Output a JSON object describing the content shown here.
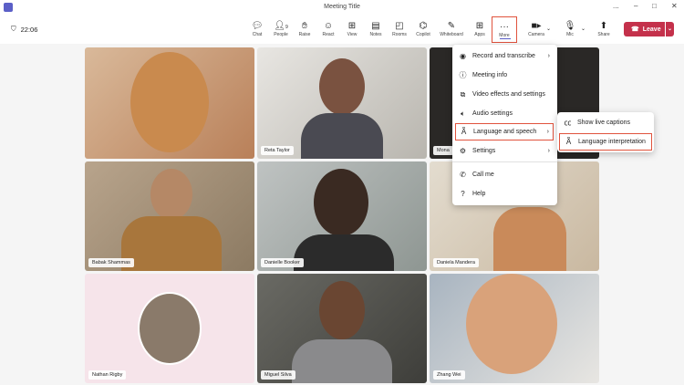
{
  "window": {
    "title": "Meeting Title",
    "controls": [
      "...",
      "–",
      "□",
      "✕"
    ]
  },
  "toolbar": {
    "timer": "22:06",
    "people_count": "9",
    "buttons": [
      {
        "label": "Chat",
        "icon": "chat-icon"
      },
      {
        "label": "People",
        "icon": "people-icon"
      },
      {
        "label": "Raise",
        "icon": "raise-hand-icon"
      },
      {
        "label": "React",
        "icon": "react-icon"
      },
      {
        "label": "View",
        "icon": "view-icon"
      },
      {
        "label": "Notes",
        "icon": "notes-icon"
      },
      {
        "label": "Rooms",
        "icon": "rooms-icon"
      },
      {
        "label": "Copilot",
        "icon": "copilot-icon"
      },
      {
        "label": "Whiteboard",
        "icon": "whiteboard-icon"
      },
      {
        "label": "Apps",
        "icon": "apps-icon"
      },
      {
        "label": "More",
        "icon": "more-icon"
      },
      {
        "label": "Camera",
        "icon": "camera-icon"
      },
      {
        "label": "Mic",
        "icon": "mic-icon"
      },
      {
        "label": "Share",
        "icon": "share-icon"
      }
    ],
    "leave_label": "Leave",
    "accent": "#5b5fc7",
    "leave_color": "#c4314b"
  },
  "participants": [
    {
      "name": ""
    },
    {
      "name": "Reta Taylor"
    },
    {
      "name": "Mona"
    },
    {
      "name": "Babak Shammas"
    },
    {
      "name": "Danielle Booker"
    },
    {
      "name": "Daniela Mandera"
    },
    {
      "name": "Nathan Rigby"
    },
    {
      "name": "Miguel Silva"
    },
    {
      "name": "Zhang Wei"
    }
  ],
  "more_menu": {
    "items": [
      {
        "label": "Record and transcribe",
        "icon": "record-icon",
        "submenu": true
      },
      {
        "label": "Meeting info",
        "icon": "info-icon"
      },
      {
        "label": "Video effects and settings",
        "icon": "video-effects-icon"
      },
      {
        "label": "Audio settings",
        "icon": "audio-settings-icon"
      },
      {
        "label": "Language and speech",
        "icon": "language-icon",
        "submenu": true,
        "highlighted": true
      },
      {
        "label": "Settings",
        "icon": "gear-icon",
        "submenu": true
      },
      {
        "label": "Call me",
        "icon": "phone-icon"
      },
      {
        "label": "Help",
        "icon": "help-icon"
      }
    ]
  },
  "language_submenu": {
    "items": [
      {
        "label": "Show live captions",
        "icon": "captions-icon"
      },
      {
        "label": "Language interpretation",
        "icon": "language-icon",
        "highlighted": true
      }
    ]
  }
}
